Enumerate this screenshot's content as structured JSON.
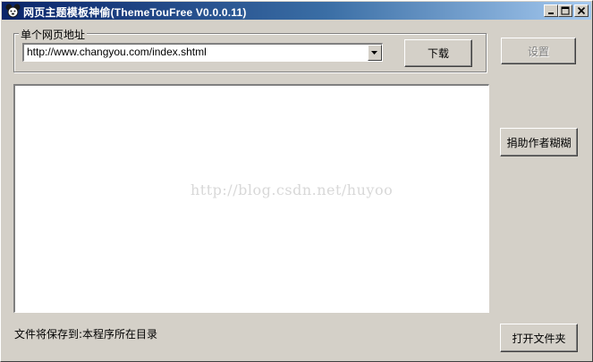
{
  "window": {
    "title": "网页主题模板神偷(ThemeTouFree V0.0.0.11)",
    "icon": "app-icon"
  },
  "titlebar_buttons": {
    "minimize_icon": "minimize-icon",
    "maximize_icon": "maximize-icon",
    "close_icon": "close-icon"
  },
  "url_group": {
    "label": "单个网页地址",
    "url_value": "http://www.changyou.com/index.shtml",
    "dropdown_icon": "chevron-down-icon"
  },
  "buttons": {
    "download": "下载",
    "settings": "设置",
    "donate": "捐助作者糊糊",
    "open_folder": "打开文件夹"
  },
  "output": {
    "watermark": "http://blog.csdn.net/huyoo"
  },
  "status": {
    "save_location": "文件将保存到:本程序所在目录"
  },
  "colors": {
    "face": "#d4d0c8",
    "title_start": "#0a246a",
    "title_end": "#a6caf0",
    "disabled_text": "#808080"
  }
}
